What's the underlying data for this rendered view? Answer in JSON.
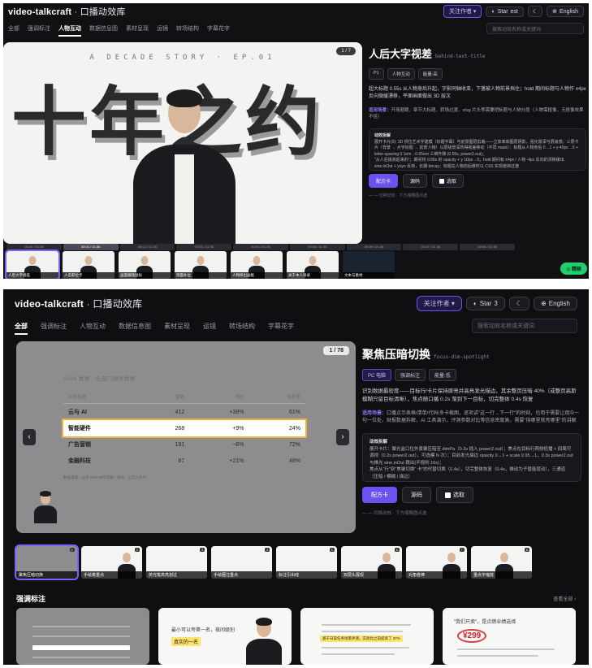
{
  "shot1": {
    "brand": "video-talkcraft",
    "brand_sub": "· 口播动效库",
    "top_actions": {
      "follow": "关注作者 ▾",
      "star": "Star",
      "star_count": "est",
      "lang": "English"
    },
    "nav": [
      "全部",
      "强调标注",
      "人物互动",
      "数据信息图",
      "素材呈现",
      "运镜",
      "转场结构",
      "字幕花字"
    ],
    "search_placeholder": "搜索动效名称或关键词",
    "hero": {
      "kicker": "A DECADE STORY · EP.01",
      "big_text": "十年之约",
      "pager": "1 / 7"
    },
    "detail": {
      "title": "人后大字视差",
      "code": "behind-text-title",
      "tags": [
        "P1",
        "人物互动",
        "能量:高"
      ],
      "desc": "超大标题 0.55s 从人物身后升起，字影同轴收束，下落被人物前景挡住；hold 期间标题与人物作 ±4px 反向微缓漂移，平面画面做出 3D 层次",
      "usage_label": "适用场景：",
      "usage": "开场题眼、章节大标题、转场过渡、vlog 片头等需要把标题与人物分层（人物需抠像，无抠像效果不佳）",
      "section_title": "动效拆解",
      "lines": [
        "展开卡片(0): 3D 供位艺术字建模（标题字幕）与前景图层剪裁——立体率和图层阴影，强化景深与层级感；三层卡片（背景 → 大字标题 → 前景人物）以层级景深所得视差移动（不同 mask）：标题从人物身后 0→1 + y 40px→0 + letter-spacing 0.1em→0.05em 三维升降 (0.55s, power2.out)；",
        "\"从人后拔高起来的\"；期间将 0.55s 的 opacity + y 10px→0；hold 期间有 ±4px / 人物 -4px 反向的漂移缓出 sine.inOut + yoyo 反转，长期 decay；标题在人物前后移时以 CSS 实现遮挡过渡"
      ],
      "buttons": {
        "primary": "配方卡",
        "secondary": "源码",
        "checkbox": "选取"
      },
      "footer": "— — 切换动效 · 下方缩略图点选"
    },
    "timeline": [
      "00:00 / 01:36",
      "00:01 / 01:36",
      "00:02 / 01:36",
      "00:03 / 01:36",
      "00:04 / 01:36",
      "00:05 / 01:36",
      "00:06 / 01:36",
      "00:07 / 01:36",
      "00:08 / 01:36"
    ],
    "thumbs": [
      "人后大字视差",
      "人名职位卡",
      "画面跟随鼠标",
      "",
      "侧面补位",
      "人物探出画框",
      "关于本人语录",
      "文本与素材"
    ],
    "fab": "◎ 精修"
  },
  "shot2": {
    "brand": "video-talkcraft",
    "brand_sub": "· 口播动效库",
    "top_actions": {
      "follow": "关注作者 ▾",
      "star": "Star",
      "star_count": "3",
      "lang": "English"
    },
    "nav": [
      "全部",
      "强调标注",
      "人物互动",
      "数据信息图",
      "素材呈现",
      "运镜",
      "转场结构",
      "字幕花字"
    ],
    "search_placeholder": "搜索动效名称或关键词",
    "hero": {
      "pager": "1 / 78",
      "card_title": "2024 数据 · 全部门财务数据",
      "columns": [
        "业务板块",
        "营收",
        "同比",
        "毛利率"
      ],
      "rows": [
        {
          "name": "云与 AI",
          "rev": "412",
          "yoy": "+38%",
          "margin": "61%"
        },
        {
          "name": "智能硬件",
          "rev": "268",
          "yoy": "+9%",
          "margin": "24%"
        },
        {
          "name": "广告营销",
          "rev": "191",
          "yoy": "−6%",
          "margin": "72%"
        },
        {
          "name": "金融科技",
          "rev": "87",
          "yoy": "+21%",
          "margin": "48%"
        }
      ],
      "focus_row": 1,
      "note": "数据来源：公司 2024 财年年报 · 单位：亿元人民币"
    },
    "detail": {
      "title": "聚焦压暗切换",
      "code": "focus-dim-spotlight",
      "tags": [
        "PC 电脑",
        "强调标注",
        "能量:低"
      ],
      "desc": "识别数据最密度——目标行/卡片保持原亮并高亮发光描边，其余整页压暗 40%（或整页高斯模糊只留目标清晰），焦点随口播 0.2s 渐到下一目标，切完整体 0.4s 恢复",
      "usage_label": "适用场景：",
      "usage": "口播点示表格/清单/代码/多卡截图，逐项讲\"这一行→下一行\"的时刻，也用于需要让观众一句一位处，财报数据拆解，AI 工具演示，评测参数对比等信息密度高，需要\"指哪里就亮哪里\"的讲解"
    },
    "section": {
      "title": "动效拆解",
      "lines": [
        "展开卡片：聚光盒口位外景聚压暗至 dimPa（0.2s 插入 power2.out）；焦点在目标行两侧低播 + 四周可调视（0.2s power2.out），可选模 N 次）；目前发光描边 opacity 0→1 + scale 0.95→1，0.3s power2.out 与推光 sine.inOut 跳出(不规则 16s)；",
        "焦点从\"行\"到\"焦聚切换\" 卡\"的代替切换（0.4s），切完整体恢复（0.4s，推动为子替能层动），三通道（压暗 / 模糊 / 描边）"
      ]
    },
    "buttons": {
      "primary": "配方卡",
      "secondary": "源码",
      "checkbox": "选取"
    },
    "footer": "— — 切换动效 · 下方缩略图点选",
    "thumbs": [
      "聚焦压暗切换",
      "手绘着重点",
      "荧光笔高亮划过",
      "手绘圈注重点",
      "标注引出线",
      "双层头展现",
      "对角卷棒",
      "重点字缩放",
      "数据强调切换"
    ],
    "gallery_title": "强调标注",
    "gallery_more": "查看全部 ›",
    "gallery": [
      {
        "kind": "table"
      },
      {
        "kind": "person",
        "text1": "最小可以夸第一名，夜间级别",
        "hl": "真实的一名"
      },
      {
        "kind": "doc",
        "hl": "基于日常任务场景评测，实际比之前提高了 37%"
      },
      {
        "kind": "price",
        "head": "\"我们只卖\"，是点燃业绩选择",
        "price": "¥299"
      }
    ]
  }
}
